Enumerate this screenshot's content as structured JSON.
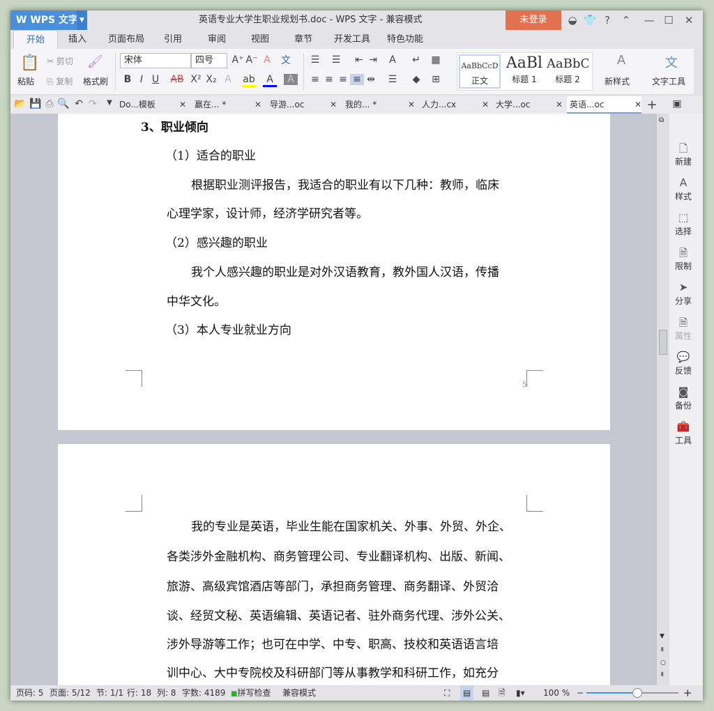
{
  "app": {
    "name": "WPS 文字",
    "title": "英语专业大学生职业规划书.doc - WPS 文字 - 兼容模式",
    "login": "未登录"
  },
  "menu": [
    "开始",
    "插入",
    "页面布局",
    "引用",
    "审阅",
    "视图",
    "章节",
    "开发工具",
    "特色功能"
  ],
  "ribbon": {
    "paste": "粘贴",
    "cut": "剪切",
    "copy": "复制",
    "format_painter": "格式刷",
    "font": "宋体",
    "size": "四号",
    "styles": [
      {
        "preview": "AaBbCcD",
        "label": "正文"
      },
      {
        "preview": "AaBl",
        "label": "标题 1"
      },
      {
        "preview": "AaBbC",
        "label": "标题 2"
      }
    ],
    "new_style": "新样式",
    "text_tools": "文字工具"
  },
  "doc_tabs": [
    "Do...模板",
    "赢在... *",
    "导游...oc",
    "我的... *",
    "人力...cx",
    "大学...oc",
    "英语...oc"
  ],
  "page1": {
    "heading": "3、职业倾向",
    "lines": [
      "（1）适合的职业",
      "根据职业测评报告，我适合的职业有以下几种：教师，临床",
      "心理学家，设计师，经济学研究者等。",
      "（2）感兴趣的职业",
      "我个人感兴趣的职业是对外汉语教育，教外国人汉语，传播",
      "中华文化。",
      "（3）本人专业就业方向"
    ],
    "page_number": "5"
  },
  "page2": {
    "lines": [
      "我的专业是英语，毕业生能在国家机关、外事、外贸、外企、",
      "各类涉外金融机构、商务管理公司、专业翻译机构、出版、新闻、",
      "旅游、高级宾馆酒店等部门，承担商务管理、商务翻译、外贸洽",
      "谈、经贸文秘、英语编辑、英语记者、驻外商务代理、涉外公关、",
      "涉外导游等工作；也可在中学、中专、职高、技校和英语语言培",
      "训中心、大中专院校及科研部门等从事教学和科研工作，如充分"
    ]
  },
  "sidebar": [
    "新建",
    "样式",
    "选择",
    "限制",
    "分享",
    "属性",
    "反馈",
    "备份",
    "工具"
  ],
  "status": {
    "page_code": "页码: 5",
    "page": "页面: 5/12",
    "section": "节: 1/1",
    "row": "行: 18",
    "col": "列: 8",
    "words": "字数: 4189",
    "spell": "拼写检查",
    "mode": "兼容模式",
    "zoom": "100 %",
    "zoom_value": 100
  },
  "colors": {
    "brand": "#4a8fdc",
    "login": "#e2714f"
  }
}
